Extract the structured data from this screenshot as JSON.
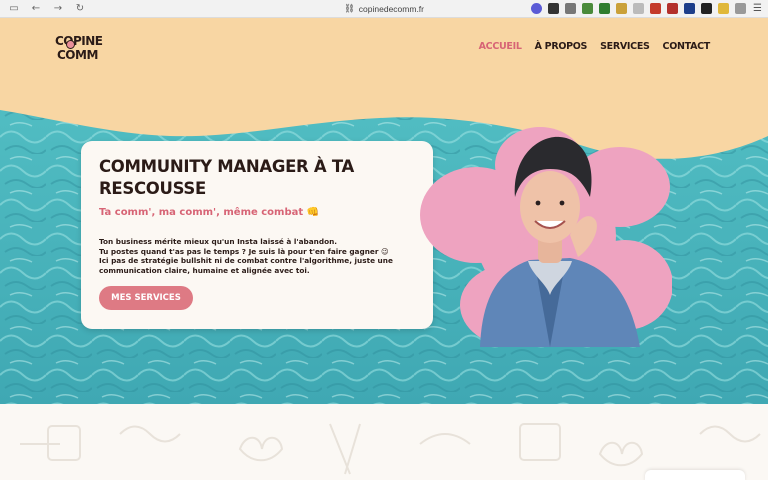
{
  "browser": {
    "url": "copinedecomm.fr",
    "back_icon": "back-arrow-icon",
    "forward_icon": "forward-arrow-icon",
    "reload_icon": "reload-icon"
  },
  "header": {
    "logo_line1": "COPINE",
    "logo_line2": "COMM",
    "nav": [
      {
        "label": "ACCUEIL",
        "active": true
      },
      {
        "label": "À PROPOS",
        "active": false
      },
      {
        "label": "SERVICES",
        "active": false
      },
      {
        "label": "CONTACT",
        "active": false
      }
    ]
  },
  "hero": {
    "title": "COMMUNITY MANAGER À TA RESCOUSSE",
    "subtitle": "Ta comm', ma comm', même combat 👊",
    "body_line1": "Ton business mérite mieux qu'un Insta laissé à l'abandon.",
    "body_line2": "Tu postes quand t'as pas le temps ? Je suis là pour t'en faire gagner 😉",
    "body_line3": "Ici pas de stratégie bullshit ni de combat contre l'algorithme, juste une communication claire, humaine et alignée avec toi.",
    "cta_label": "MES SERVICES"
  },
  "colors": {
    "header_bg": "#f8d6a3",
    "accent_pink": "#d76475",
    "button_pink": "#de7a84",
    "flower_pink": "#eea3c0",
    "pool_teal": "#4fb9c0",
    "text_dark": "#2b1b17"
  }
}
